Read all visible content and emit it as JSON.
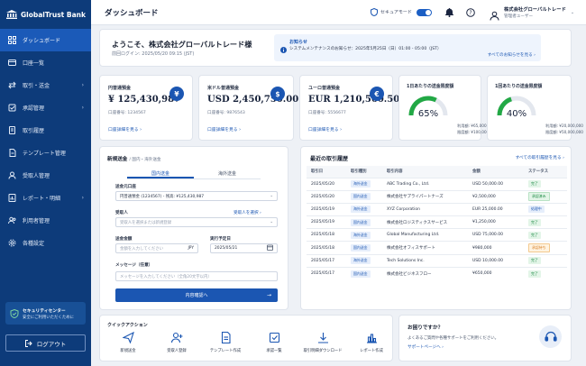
{
  "brand": "GlobalTrust Bank",
  "sidebar": {
    "items": [
      {
        "label": "ダッシュボード",
        "icon": "grid-icon"
      },
      {
        "label": "口座一覧",
        "icon": "card-icon"
      },
      {
        "label": "取引・送金",
        "icon": "transfer-icon",
        "chevron": "›"
      },
      {
        "label": "承認管理",
        "icon": "approval-icon",
        "chevron": "›"
      },
      {
        "label": "取引履歴",
        "icon": "history-icon"
      },
      {
        "label": "テンプレート管理",
        "icon": "template-icon"
      },
      {
        "label": "受取人管理",
        "icon": "person-icon"
      },
      {
        "label": "レポート・明細",
        "icon": "report-icon",
        "chevron": "›"
      },
      {
        "label": "利用者管理",
        "icon": "users-icon"
      },
      {
        "label": "各種設定",
        "icon": "gear-icon"
      }
    ],
    "security_title": "セキュリティセンター",
    "security_text": "安全にご利用いただくために",
    "logout": "ログアウト"
  },
  "topbar": {
    "title": "ダッシュボード",
    "security_mode": "セキュアモード",
    "user_name": "株式会社グローバルトレード",
    "user_role": "管理者ユーザー"
  },
  "welcome": {
    "heading": "ようこそ、株式会社グローバルトレード様",
    "last_login": "前回ログイン: 2025/05/20 09:15 (JST)"
  },
  "notice": {
    "title": "お知らせ",
    "message": "システムメンテナンスのお知らせ：2025年5月25日（日）01:00 - 05:00（JST）",
    "link": "すべてのお知らせを見る ›"
  },
  "accounts": [
    {
      "label": "円普通預金",
      "amount": "¥ 125,430,987",
      "number": "口座番号: 1234567",
      "link": "口座詳細を見る ›",
      "currency_symbol": "¥"
    },
    {
      "label": "米ドル普通預金",
      "amount": "USD 2,450,750.00",
      "number": "口座番号: 9876543",
      "link": "口座詳細を見る ›",
      "currency_symbol": "$"
    },
    {
      "label": "ユーロ普通預金",
      "amount": "EUR 1,210,560.50",
      "number": "口座番号: 5556677",
      "link": "口座詳細を見る ›",
      "currency_symbol": "€"
    }
  ],
  "limits": [
    {
      "label": "1日あたりの送金限度額",
      "percent": 65,
      "percent_text": "65%",
      "used": "利用額: ¥65,000,000",
      "limit": "限度額: ¥100,000,000",
      "color": "#22a845"
    },
    {
      "label": "1回あたりの送金限度額",
      "percent": 40,
      "percent_text": "40%",
      "used": "利用額: ¥20,000,000",
      "limit": "限度額: ¥50,000,000",
      "color": "#22a845"
    }
  ],
  "transfer": {
    "title": "新規送金",
    "subtitle": "/ 国内・海外送金",
    "tabs": [
      "国内送金",
      "海外送金"
    ],
    "from_label": "送金元口座",
    "from_value": "円普通預金 (1234567) - 残高: ¥125,430,987",
    "payee_label": "受取人",
    "payee_link": "受取人を選択 ›",
    "payee_placeholder": "受取人を選択または新規登録",
    "amount_label": "送金金額",
    "amount_placeholder": "金額を入力してください",
    "amount_currency": "JPY",
    "date_label": "実行予定日",
    "date_value": "2025/05/21",
    "message_label": "メッセージ（任意）",
    "message_placeholder": "メッセージを入力してください（全角20文字以内）",
    "submit": "内容確認へ"
  },
  "recent": {
    "title": "最近の取引履歴",
    "link": "すべての取引履歴を見る ›",
    "columns": [
      "取引日",
      "取引種別",
      "取引内容",
      "金額",
      "ステータス"
    ],
    "rows": [
      {
        "date": "2025/05/20",
        "type": "海外送金",
        "desc": "ABC Trading Co., Ltd.",
        "amount": "USD 50,000.00",
        "status": "完了",
        "status_class": "done"
      },
      {
        "date": "2025/05/20",
        "type": "国内送金",
        "desc": "株式会社サプライパートナーズ",
        "amount": "¥2,500,000",
        "status": "承認済み",
        "status_class": "ok"
      },
      {
        "date": "2025/05/19",
        "type": "海外送金",
        "desc": "XYZ Corporation",
        "amount": "EUR 25,000.00",
        "status": "処理中",
        "status_class": "proc"
      },
      {
        "date": "2025/05/19",
        "type": "国内送金",
        "desc": "株式会社ロジスティクスサービス",
        "amount": "¥1,250,000",
        "status": "完了",
        "status_class": "done"
      },
      {
        "date": "2025/05/18",
        "type": "海外送金",
        "desc": "Global Manufacturing Ltd.",
        "amount": "USD 75,000.00",
        "status": "完了",
        "status_class": "done"
      },
      {
        "date": "2025/05/18",
        "type": "国内送金",
        "desc": "株式会社オフィスサポート",
        "amount": "¥980,000",
        "status": "承認待ち",
        "status_class": "wait"
      },
      {
        "date": "2025/05/17",
        "type": "海外送金",
        "desc": "Tech Solutions Inc.",
        "amount": "USD 10,000.00",
        "status": "完了",
        "status_class": "done"
      },
      {
        "date": "2025/05/17",
        "type": "国内送金",
        "desc": "株式会社ビジネスフロー",
        "amount": "¥650,000",
        "status": "完了",
        "status_class": "done"
      }
    ]
  },
  "quick": {
    "title": "クイックアクション",
    "actions": [
      {
        "label": "新規送金",
        "icon": "send-icon"
      },
      {
        "label": "受取人登録",
        "icon": "add-person-icon"
      },
      {
        "label": "テンプレート作成",
        "icon": "template-icon"
      },
      {
        "label": "承認一覧",
        "icon": "approval-list-icon"
      },
      {
        "label": "取引明細ダウンロード",
        "icon": "download-icon"
      },
      {
        "label": "レポート作成",
        "icon": "chart-icon"
      }
    ]
  },
  "help": {
    "title": "お困りですか？",
    "message": "よくあるご質問や各種サポートをご利用ください。",
    "link": "サポートページへ ›"
  },
  "colors": {
    "primary": "#1b56b2",
    "sidebar": "#0d3b7a",
    "success": "#22a845",
    "warning": "#d9822b"
  }
}
